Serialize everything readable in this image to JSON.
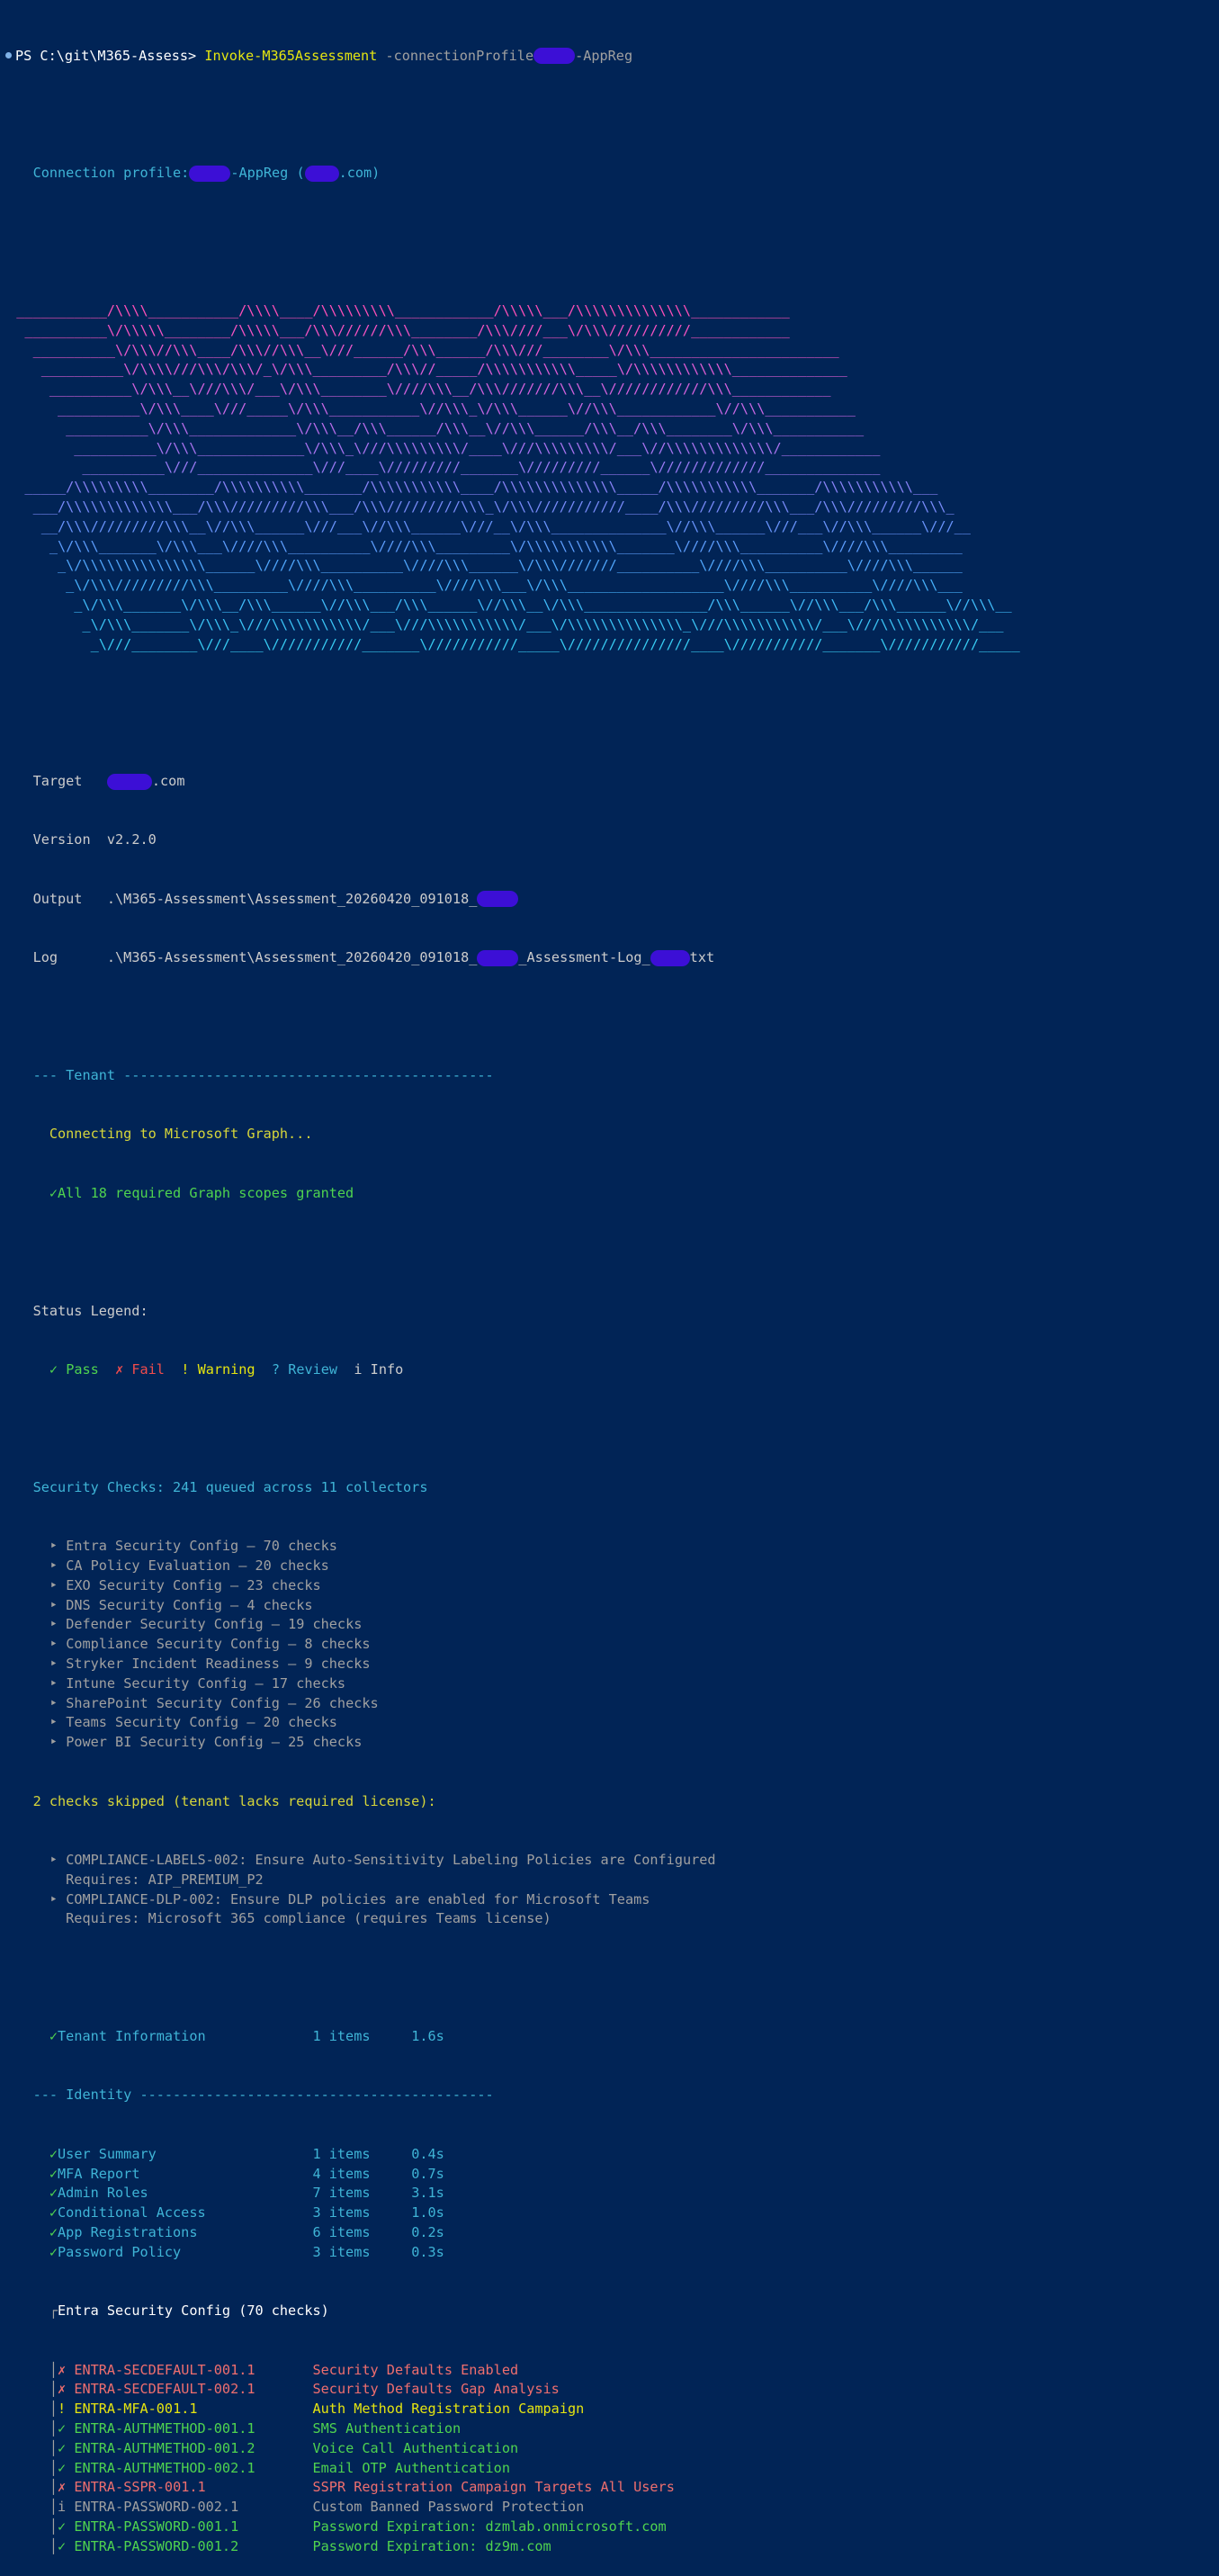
{
  "prompt": {
    "text": "PS C:\\git\\M365-Assess> ",
    "command": "Invoke-M365Assessment",
    "param": "-connectionProfile",
    "param_suffix": "-AppReg"
  },
  "connection": {
    "label": "Connection profile:",
    "profile_suffix": "-AppReg (",
    "domain_suffix": ".com)"
  },
  "banner": {
    "lines": [
      "___________/\\\\\\\\___________/\\\\\\\\____/\\\\\\\\\\\\\\\\\\____________/\\\\\\\\\\___/\\\\\\\\\\\\\\\\\\\\\\\\\\\\____________",
      " __________\\/\\\\\\\\\\________/\\\\\\\\\\___/\\\\\\//////\\\\\\________/\\\\\\////___\\/\\\\\\//////////____________",
      "  __________\\/\\\\\\//\\\\\\____/\\\\\\//\\\\\\__\\///______/\\\\\\______/\\\\\\///________\\/\\\\\\_______________________",
      "   __________\\/\\\\\\\\///\\\\\\/\\\\\\/_\\/\\\\\\_________/\\\\\\//_____/\\\\\\\\\\\\\\\\\\\\\\_____\\/\\\\\\\\\\\\\\\\\\\\\\\\______________",
      "    __________\\/\\\\\\__\\///\\\\\\/___\\/\\\\\\________\\////\\\\\\__/\\\\\\///////\\\\\\__\\////////////\\\\\\____________",
      "     __________\\/\\\\\\____\\///_____\\/\\\\\\___________\\//\\\\\\_\\/\\\\\\______\\//\\\\\\____________\\//\\\\\\___________",
      "      __________\\/\\\\\\_____________\\/\\\\\\__/\\\\\\______/\\\\\\__\\//\\\\\\______/\\\\\\__/\\\\\\________\\/\\\\\\___________",
      "       __________\\/\\\\\\_____________\\/\\\\\\_\\///\\\\\\\\\\\\\\\\\\/____\\///\\\\\\\\\\\\\\\\\\/___\\//\\\\\\\\\\\\\\\\\\\\\\\\\\/____________",
      "        __________\\///______________\\///____\\/////////_______\\/////////______\\/////////////______________",
      " _____/\\\\\\\\\\\\\\\\\\________/\\\\\\\\\\\\\\\\\\\\_______/\\\\\\\\\\\\\\\\\\\\\\____/\\\\\\\\\\\\\\\\\\\\\\\\\\\\_____/\\\\\\\\\\\\\\\\\\\\\\_______/\\\\\\\\\\\\\\\\\\\\\\___",
      "  ___/\\\\\\\\\\\\\\\\\\\\\\\\\\___/\\\\\\/////////\\\\\\___/\\\\\\/////////\\\\\\_\\/\\\\\\///////////____/\\\\\\/////////\\\\\\___/\\\\\\/////////\\\\\\_",
      "   __/\\\\\\/////////\\\\\\__\\//\\\\\\______\\///___\\//\\\\\\______\\///__\\/\\\\\\______________\\//\\\\\\______\\///___\\//\\\\\\______\\///__",
      "    _\\/\\\\\\_______\\/\\\\\\___\\////\\\\\\__________\\////\\\\\\_________\\/\\\\\\\\\\\\\\\\\\\\\\_______\\////\\\\\\__________\\////\\\\\\_________",
      "     _\\/\\\\\\\\\\\\\\\\\\\\\\\\\\\\\\______\\////\\\\\\__________\\////\\\\\\______\\/\\\\\\///////__________\\////\\\\\\__________\\////\\\\\\______",
      "      _\\/\\\\\\/////////\\\\\\_________\\////\\\\\\__________\\////\\\\\\___\\/\\\\\\___________________\\////\\\\\\__________\\////\\\\\\___",
      "       _\\/\\\\\\_______\\/\\\\\\__/\\\\\\______\\//\\\\\\___/\\\\\\______\\//\\\\\\__\\/\\\\\\_______________/\\\\\\______\\//\\\\\\___/\\\\\\______\\//\\\\\\__",
      "        _\\/\\\\\\_______\\/\\\\\\_\\///\\\\\\\\\\\\\\\\\\\\\\/___\\///\\\\\\\\\\\\\\\\\\\\\\/___\\/\\\\\\\\\\\\\\\\\\\\\\\\\\\\_\\///\\\\\\\\\\\\\\\\\\\\\\/___\\///\\\\\\\\\\\\\\\\\\\\\\/___",
      "         _\\///________\\///____\\///////////_______\\///////////_____\\///////////////____\\///////////_______\\///////////_____"
    ]
  },
  "info": {
    "target_label": "Target",
    "target_suffix": ".com",
    "version_label": "Version",
    "version": "v2.2.0",
    "output_label": "Output",
    "output_path": ".\\M365-Assessment\\Assessment_20260420_091018_",
    "log_label": "Log",
    "log_path": ".\\M365-Assessment\\Assessment_20260420_091018_",
    "log_mid": "_Assessment-Log_",
    "log_ext": "txt"
  },
  "tenant_header": "--- Tenant ---------------------------------------------",
  "connecting": "Connecting to Microsoft Graph...",
  "scopes": "All 18 required Graph scopes granted",
  "legend": {
    "title": "Status Legend:",
    "pass": "Pass",
    "fail": "Fail",
    "warning": "Warning",
    "review": "Review",
    "info": "Info"
  },
  "checks": {
    "header": "Security Checks: 241 queued across 11 collectors",
    "items": [
      "Entra Security Config — 70 checks",
      "CA Policy Evaluation — 20 checks",
      "EXO Security Config — 23 checks",
      "DNS Security Config — 4 checks",
      "Defender Security Config — 19 checks",
      "Compliance Security Config — 8 checks",
      "Stryker Incident Readiness — 9 checks",
      "Intune Security Config — 17 checks",
      "SharePoint Security Config — 26 checks",
      "Teams Security Config — 20 checks",
      "Power BI Security Config — 25 checks"
    ],
    "skipped_header": "2 checks skipped (tenant lacks required license):",
    "skipped": [
      {
        "id": "COMPLIANCE-LABELS-002: Ensure Auto-Sensitivity Labeling Policies are Configured",
        "req": "Requires: AIP_PREMIUM_P2"
      },
      {
        "id": "COMPLIANCE-DLP-002: Ensure DLP policies are enabled for Microsoft Teams",
        "req": "Requires: Microsoft 365 compliance (requires Teams license)"
      }
    ]
  },
  "tenant_info": {
    "name": "Tenant Information",
    "items": "1 items",
    "time": "1.6s"
  },
  "identity_header": "--- Identity -------------------------------------------",
  "identity": [
    {
      "name": "User Summary",
      "items": "1 items",
      "time": "0.4s"
    },
    {
      "name": "MFA Report",
      "items": "4 items",
      "time": "0.7s"
    },
    {
      "name": "Admin Roles",
      "items": "7 items",
      "time": "3.1s"
    },
    {
      "name": "Conditional Access",
      "items": "3 items",
      "time": "1.0s"
    },
    {
      "name": "App Registrations",
      "items": "6 items",
      "time": "0.2s"
    },
    {
      "name": "Password Policy",
      "items": "3 items",
      "time": "0.3s"
    }
  ],
  "entra": {
    "header": "Entra Security Config (70 checks)",
    "rows": [
      {
        "status": "fail",
        "id": "ENTRA-SECDEFAULT-001.1",
        "desc": "Security Defaults Enabled"
      },
      {
        "status": "fail",
        "id": "ENTRA-SECDEFAULT-002.1",
        "desc": "Security Defaults Gap Analysis"
      },
      {
        "status": "warning",
        "id": "ENTRA-MFA-001.1",
        "desc": "Auth Method Registration Campaign"
      },
      {
        "status": "pass",
        "id": "ENTRA-AUTHMETHOD-001.1",
        "desc": "SMS Authentication"
      },
      {
        "status": "pass",
        "id": "ENTRA-AUTHMETHOD-001.2",
        "desc": "Voice Call Authentication"
      },
      {
        "status": "pass",
        "id": "ENTRA-AUTHMETHOD-002.1",
        "desc": "Email OTP Authentication"
      },
      {
        "status": "fail",
        "id": "ENTRA-SSPR-001.1",
        "desc": "SSPR Registration Campaign Targets All Users"
      },
      {
        "status": "info",
        "id": "ENTRA-PASSWORD-002.1",
        "desc": "Custom Banned Password Protection"
      },
      {
        "status": "pass",
        "id": "ENTRA-PASSWORD-001.1",
        "desc": "Password Expiration: dzmlab.onmicrosoft.com"
      },
      {
        "status": "pass",
        "id": "ENTRA-PASSWORD-001.2",
        "desc": "Password Expiration: dz9m.com"
      }
    ]
  },
  "symbols": {
    "pass": "✓",
    "fail": "✗",
    "warning": "!",
    "review": "?",
    "info": "i",
    "bullet": "‣",
    "tree_top": "┌"
  }
}
